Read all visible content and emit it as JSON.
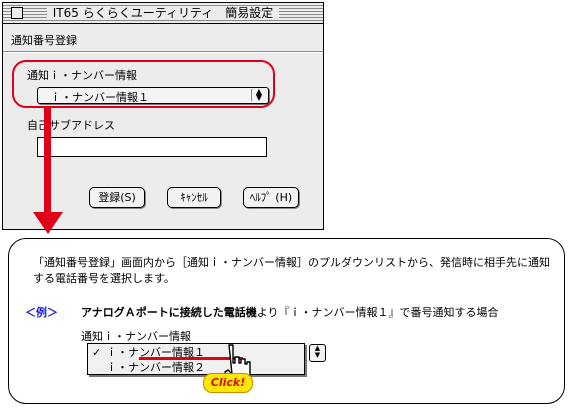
{
  "window": {
    "title": "IT65 らくらくユーティリティ　簡易設定",
    "heading": "通知番号登録",
    "notify_label": "通知ｉ・ナンバー情報",
    "notify_value": "ｉ・ナンバー情報１",
    "address_label": "自己サブアドレス",
    "address_value": "",
    "buttons": {
      "register": "登録(S)",
      "cancel": "ｷｬﾝｾﾙ",
      "help": "ﾍﾙﾌﾟ (H)"
    }
  },
  "callout": {
    "description": "「通知番号登録」画面内から［通知ｉ・ナンバー情報］のプルダウンリストから、発信時に相手先に通知する電話番号を選択します。",
    "example_tag": "＜例＞",
    "example_bold": "アナログＡポートに接続した電話機",
    "example_rest": "より『ｉ・ナンバー情報１』で番号通知する場合",
    "example_label": "通知ｉ・ナンバー情報",
    "menu_items": [
      "ｉ・ナンバー情報１",
      "ｉ・ナンバー情報２"
    ],
    "checkmark": "✓",
    "click_badge": "Click!"
  },
  "colors": {
    "highlight": "#e0001a",
    "example_tag": "#1a1ad6",
    "badge": "#ffe600"
  }
}
